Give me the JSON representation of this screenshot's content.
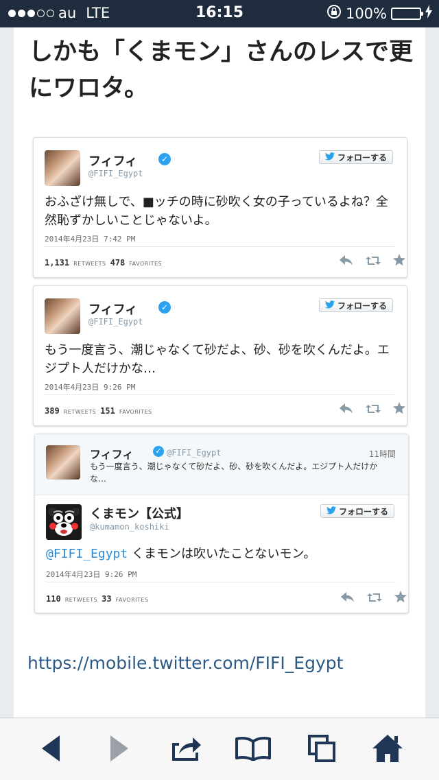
{
  "status_bar": {
    "carrier": "au",
    "network": "LTE",
    "time": "16:15",
    "battery": "100%",
    "battery_color": "#4cd964"
  },
  "headline": "しかも「くまモン」さんのレスで更にワロタ。",
  "tweets": [
    {
      "name": "フィフィ",
      "handle": "@FIFI_Egypt",
      "follow_label": "フォローする",
      "text": "おふざけ無しで、■ッチの時に砂吹く女の子っているよね？全然恥ずかしいことじゃないよ。",
      "timestamp": "2014年4月23日 7:42 PM",
      "retweets": "1,131",
      "retweets_label": "RETWEETS",
      "favorites": "478",
      "favorites_label": "FAVORITES"
    },
    {
      "name": "フィフィ",
      "handle": "@FIFI_Egypt",
      "follow_label": "フォローする",
      "text": "もう一度言う、潮じゃなくて砂だよ、砂、砂を吹くんだよ。エジプト人だけかな…",
      "timestamp": "2014年4月23日 9:26 PM",
      "retweets": "389",
      "retweets_label": "RETWEETS",
      "favorites": "151",
      "favorites_label": "FAVORITES"
    }
  ],
  "reply": {
    "context": {
      "name": "フィフィ",
      "handle": "@FIFI_Egypt",
      "time_ago": "11時間",
      "text": "もう一度言う、潮じゃなくて砂だよ、砂、砂を吹くんだよ。エジプト人だけかな…"
    },
    "name": "くまモン【公式】",
    "handle": "@kumamon_koshiki",
    "follow_label": "フォローする",
    "mention": "@FIFI_Egypt",
    "text": " くまモンは吹いたことないモン。",
    "timestamp": "2014年4月23日 9:26 PM",
    "retweets": "110",
    "retweets_label": "RETWEETS",
    "favorites": "33",
    "favorites_label": "FAVORITES"
  },
  "link": "https://mobile.twitter.com/FIFI_Egypt",
  "toolbar": {
    "icons": [
      "back-icon",
      "forward-icon",
      "share-icon",
      "bookmarks-icon",
      "tabs-icon",
      "home-icon"
    ]
  }
}
